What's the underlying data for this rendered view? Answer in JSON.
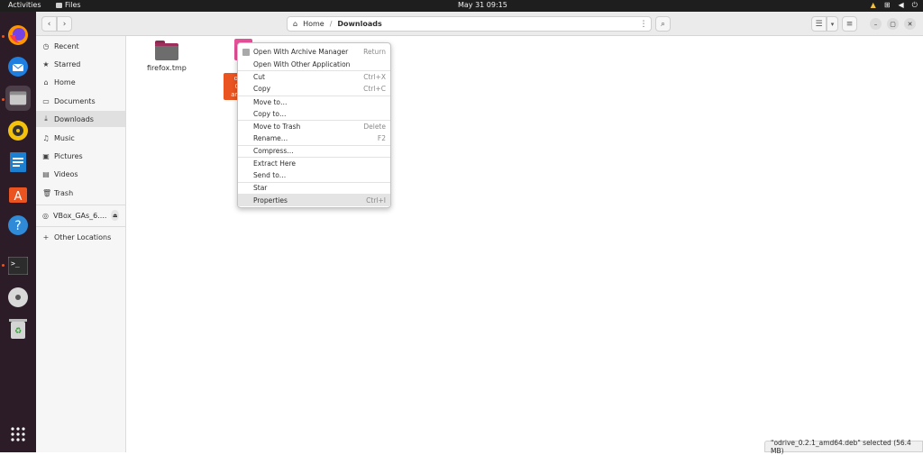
{
  "topbar": {
    "activities": "Activities",
    "app_name": "Files",
    "clock": "May 31  09:15"
  },
  "headerbar": {
    "path": [
      "Home",
      "Downloads"
    ],
    "menu_icon": "kebab-icon",
    "search_icon": "search-icon"
  },
  "sidebar": {
    "items": [
      {
        "label": "Recent",
        "icon": "clock-icon"
      },
      {
        "label": "Starred",
        "icon": "star-icon"
      },
      {
        "label": "Home",
        "icon": "home-icon"
      },
      {
        "label": "Documents",
        "icon": "document-icon"
      },
      {
        "label": "Downloads",
        "icon": "download-icon",
        "active": true
      },
      {
        "label": "Music",
        "icon": "music-icon"
      },
      {
        "label": "Pictures",
        "icon": "picture-icon"
      },
      {
        "label": "Videos",
        "icon": "video-icon"
      },
      {
        "label": "Trash",
        "icon": "trash-icon"
      }
    ],
    "device": {
      "label": "VBox_GAs_6....",
      "icon": "disc-icon"
    },
    "other": {
      "label": "Other Locations",
      "icon": "plus-icon"
    }
  },
  "files": [
    {
      "name": "firefox.tmp",
      "type": "folder"
    },
    {
      "name": "odrive_0.2.1_amd64.deb",
      "label_lines": [
        "od",
        "0.",
        "amd"
      ],
      "type": "deb"
    }
  ],
  "context_menu": {
    "items": [
      {
        "label": "Open With Archive Manager",
        "accel": "Return"
      },
      {
        "label": "Open With Other Application",
        "accel": ""
      },
      {
        "label": "Cut",
        "accel": "Ctrl+X"
      },
      {
        "label": "Copy",
        "accel": "Ctrl+C"
      },
      {
        "label": "Move to…",
        "accel": ""
      },
      {
        "label": "Copy to…",
        "accel": ""
      },
      {
        "label": "Move to Trash",
        "accel": "Delete"
      },
      {
        "label": "Rename…",
        "accel": "F2"
      },
      {
        "label": "Compress…",
        "accel": ""
      },
      {
        "label": "Extract Here",
        "accel": ""
      },
      {
        "label": "Send to…",
        "accel": ""
      },
      {
        "label": "Star",
        "accel": ""
      },
      {
        "label": "Properties",
        "accel": "Ctrl+I"
      }
    ]
  },
  "status": {
    "text": "\"odrive_0.2.1_amd64.deb\" selected  (56.4 MB)"
  }
}
